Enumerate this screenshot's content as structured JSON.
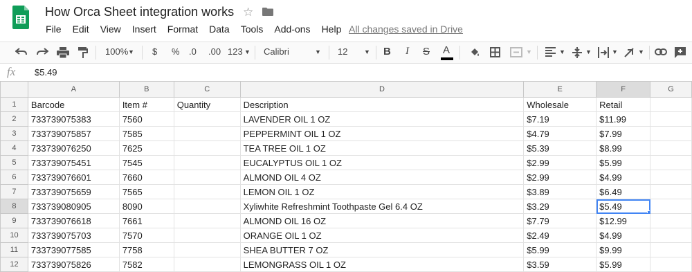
{
  "doc": {
    "title": "How Orca Sheet integration works",
    "saved_status": "All changes saved in Drive"
  },
  "menu": [
    "File",
    "Edit",
    "View",
    "Insert",
    "Format",
    "Data",
    "Tools",
    "Add-ons",
    "Help"
  ],
  "toolbar": {
    "zoom": "100%",
    "currency": "$",
    "percent": "%",
    "dec_decrease": ".0",
    "dec_increase": ".00",
    "more_formats": "123",
    "font": "Calibri",
    "font_size": "12",
    "bold": "B",
    "italic": "I",
    "text_color_letter": "A"
  },
  "formula_bar": {
    "fx": "fx",
    "value": "$5.49"
  },
  "columns": [
    "A",
    "B",
    "C",
    "D",
    "E",
    "F",
    "G"
  ],
  "active_cell": {
    "row": 8,
    "col": "F"
  },
  "rows": [
    {
      "n": "1",
      "cells": [
        "Barcode",
        "Item #",
        "Quantity",
        "Description",
        "Wholesale",
        "Retail",
        ""
      ]
    },
    {
      "n": "2",
      "cells": [
        "733739075383",
        "7560",
        "",
        "LAVENDER OIL  1 OZ",
        "$7.19",
        "$11.99",
        ""
      ]
    },
    {
      "n": "3",
      "cells": [
        "733739075857",
        "7585",
        "",
        "PEPPERMINT OIL  1 OZ",
        "$4.79",
        "$7.99",
        ""
      ]
    },
    {
      "n": "4",
      "cells": [
        "733739076250",
        "7625",
        "",
        "TEA TREE OIL  1 OZ",
        "$5.39",
        "$8.99",
        ""
      ]
    },
    {
      "n": "5",
      "cells": [
        "733739075451",
        "7545",
        "",
        "EUCALYPTUS OIL  1 OZ",
        "$2.99",
        "$5.99",
        ""
      ]
    },
    {
      "n": "6",
      "cells": [
        "733739076601",
        "7660",
        "",
        "ALMOND OIL 4 OZ",
        "$2.99",
        "$4.99",
        ""
      ]
    },
    {
      "n": "7",
      "cells": [
        "733739075659",
        "7565",
        "",
        "LEMON OIL  1 OZ",
        "$3.89",
        "$6.49",
        ""
      ]
    },
    {
      "n": "8",
      "cells": [
        "733739080905",
        "8090",
        "",
        "Xyliwhite Refreshmint Toothpaste Gel  6.4 OZ",
        "$3.29",
        "$5.49",
        ""
      ]
    },
    {
      "n": "9",
      "cells": [
        "733739076618",
        "7661",
        "",
        "ALMOND OIL  16 OZ",
        "$7.79",
        "$12.99",
        ""
      ]
    },
    {
      "n": "10",
      "cells": [
        "733739075703",
        "7570",
        "",
        "ORANGE OIL  1 OZ",
        "$2.49",
        "$4.99",
        ""
      ]
    },
    {
      "n": "11",
      "cells": [
        "733739077585",
        "7758",
        "",
        "SHEA BUTTER  7 OZ",
        "$5.99",
        "$9.99",
        ""
      ]
    },
    {
      "n": "12",
      "cells": [
        "733739075826",
        "7582",
        "",
        "LEMONGRASS OIL 1 OZ",
        "$3.59",
        "$5.99",
        ""
      ]
    }
  ]
}
